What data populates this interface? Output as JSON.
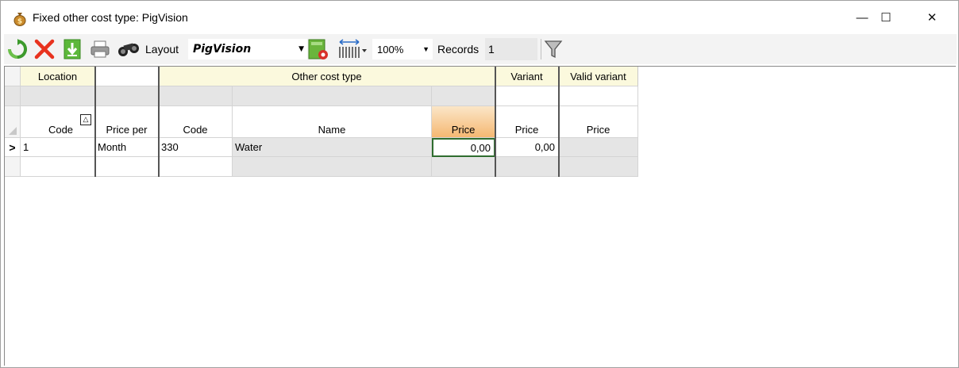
{
  "window": {
    "title": "Fixed other cost type: PigVision",
    "minimize": "—",
    "maximize": "☐",
    "close": "✕"
  },
  "toolbar": {
    "icons": [
      "refresh-icon",
      "delete-icon",
      "save-icon",
      "print-icon",
      "binoculars-icon",
      "layout-settings-icon",
      "column-width-icon",
      "filter-icon"
    ],
    "layout_label": "Layout",
    "layout_value": "PigVision",
    "zoom_value": "100%",
    "records_label": "Records",
    "records_value": "1"
  },
  "grid": {
    "bands": {
      "location": "Location",
      "other_cost_type": "Other cost type",
      "variant": "Variant",
      "valid_variant": "Valid variant"
    },
    "headers": {
      "code": "Code",
      "price_per": "Price per",
      "oct_code": "Code",
      "name": "Name",
      "price": "Price",
      "variant_price": "Price",
      "valid_variant_price": "Price"
    },
    "sort_indicator": "△",
    "row_marker": ">",
    "rows": [
      {
        "code": "1",
        "price_per": "Month",
        "oct_code": "330",
        "name": "Water",
        "price": "0,00",
        "variant_price": "0,00",
        "valid_variant_price": ""
      }
    ]
  },
  "colors": {
    "band_bg": "#fbf9dd",
    "sorted_header": "#f5b872",
    "focus_border": "#2f6d2f"
  }
}
